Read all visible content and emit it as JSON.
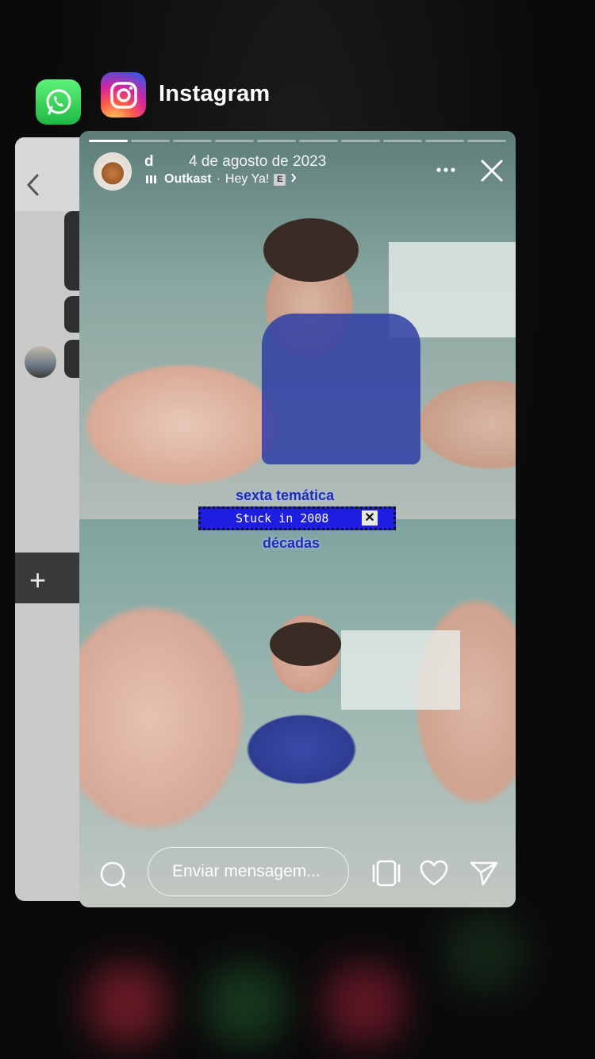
{
  "app_switcher": {
    "whatsapp_icon": "whatsapp-icon",
    "instagram_icon": "instagram-icon",
    "current_app_title": "Instagram"
  },
  "story": {
    "progress_total_segments": 10,
    "progress_current_segment": 1,
    "username": "d",
    "date": "4 de agosto de 2023",
    "music": {
      "artist": "Outkast",
      "separator": "·",
      "song": "Hey Ya!",
      "explicit_badge": "E"
    },
    "stickers": {
      "caption_top": "sexta temática",
      "window_title": "Stuck in 2008",
      "window_close": "✕",
      "caption_bottom": "décadas"
    },
    "reply": {
      "placeholder": "Enviar mensagem..."
    }
  },
  "colors": {
    "sticker_blue": "#1e1ee0",
    "caption_text": "#2a2aa8"
  }
}
